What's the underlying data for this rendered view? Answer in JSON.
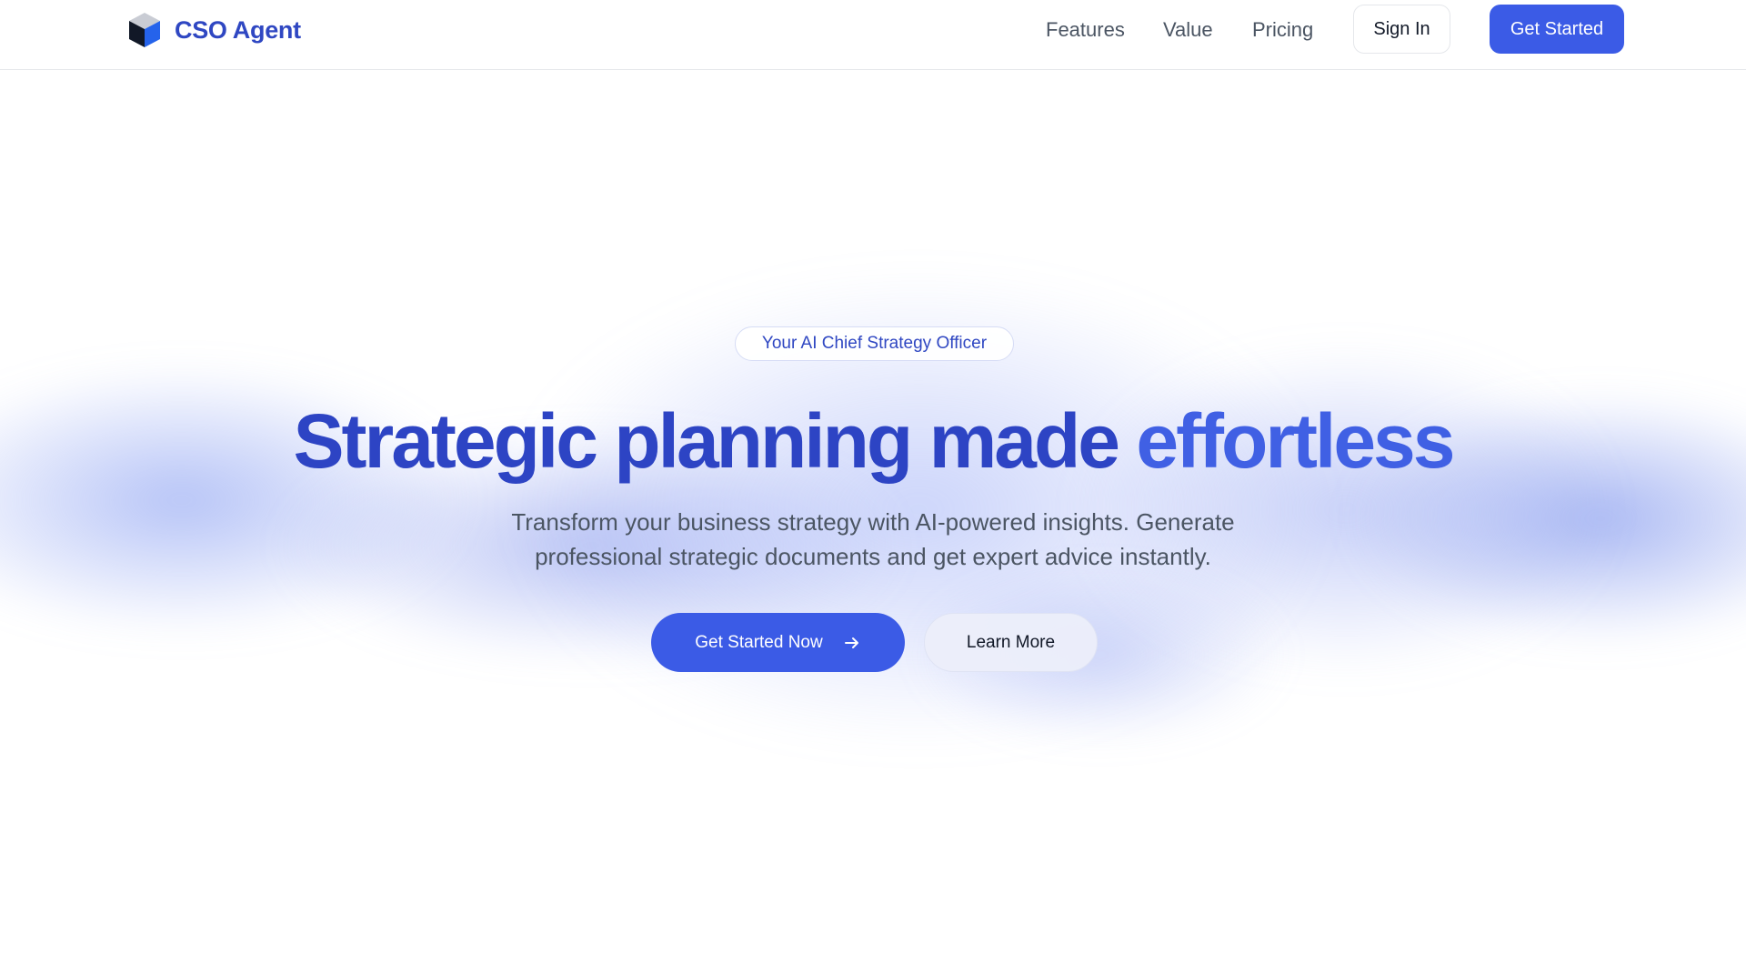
{
  "header": {
    "brand_name": "CSO Agent",
    "logo_icon": "cube-logo-icon",
    "nav": {
      "features": "Features",
      "value": "Value",
      "pricing": "Pricing"
    },
    "sign_in_label": "Sign In",
    "get_started_label": "Get Started"
  },
  "hero": {
    "badge": "Your AI Chief Strategy Officer",
    "headline_main": "Strategic planning made ",
    "headline_accent": "effortless",
    "subtitle": "Transform your business strategy with AI-powered insights. Generate professional strategic documents and get expert advice instantly.",
    "cta_primary_label": "Get Started Now",
    "cta_primary_icon": "arrow-right-icon",
    "cta_secondary_label": "Learn More"
  },
  "colors": {
    "brand": "#2f47c2",
    "accent": "#3b5be6",
    "headline_accent": "#4060e4",
    "text_muted": "#4b5563"
  }
}
